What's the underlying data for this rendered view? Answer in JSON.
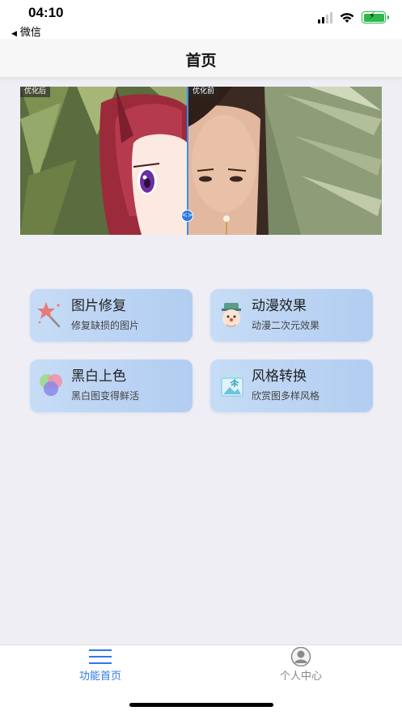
{
  "status_bar": {
    "time": "04:10",
    "back_app": "微信",
    "back_icon": "back-triangle-icon",
    "battery_color": "#2db84d"
  },
  "nav": {
    "title": "首页"
  },
  "compare": {
    "left_tag": "优化后",
    "right_tag": "优化前",
    "handle_glyph": "<>"
  },
  "features": [
    {
      "title": "图片修复",
      "subtitle": "修复缺损的图片",
      "icon": "magic-wand-star-icon"
    },
    {
      "title": "动漫效果",
      "subtitle": "动漫二次元效果",
      "icon": "cartoon-face-icon"
    },
    {
      "title": "黑白上色",
      "subtitle": "黑白图变得鲜活",
      "icon": "color-circles-icon"
    },
    {
      "title": "风格转换",
      "subtitle": "欣赏图多样风格",
      "icon": "landscape-picture-icon"
    }
  ],
  "tabs": [
    {
      "label": "功能首页",
      "icon": "menu-lines-icon",
      "active": true,
      "color": "#2f79e6"
    },
    {
      "label": "个人中心",
      "icon": "user-avatar-icon",
      "active": false,
      "color": "#888888"
    }
  ],
  "colors": {
    "accent": "#2f79e6",
    "card_bg": "#b8d2f3",
    "page_bg": "#efeef4"
  }
}
